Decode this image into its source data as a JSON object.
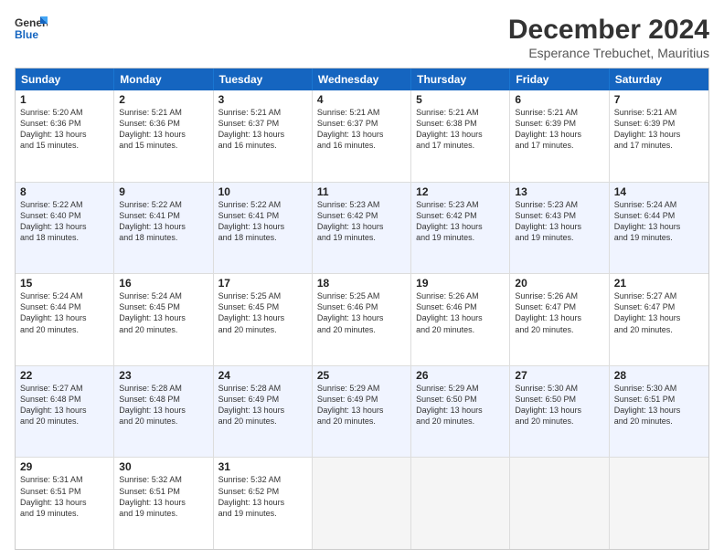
{
  "logo": {
    "line1": "General",
    "line2": "Blue"
  },
  "title": "December 2024",
  "subtitle": "Esperance Trebuchet, Mauritius",
  "header_days": [
    "Sunday",
    "Monday",
    "Tuesday",
    "Wednesday",
    "Thursday",
    "Friday",
    "Saturday"
  ],
  "rows": [
    {
      "alt": false,
      "cells": [
        {
          "day": "1",
          "lines": [
            "Sunrise: 5:20 AM",
            "Sunset: 6:36 PM",
            "Daylight: 13 hours",
            "and 15 minutes."
          ]
        },
        {
          "day": "2",
          "lines": [
            "Sunrise: 5:21 AM",
            "Sunset: 6:36 PM",
            "Daylight: 13 hours",
            "and 15 minutes."
          ]
        },
        {
          "day": "3",
          "lines": [
            "Sunrise: 5:21 AM",
            "Sunset: 6:37 PM",
            "Daylight: 13 hours",
            "and 16 minutes."
          ]
        },
        {
          "day": "4",
          "lines": [
            "Sunrise: 5:21 AM",
            "Sunset: 6:37 PM",
            "Daylight: 13 hours",
            "and 16 minutes."
          ]
        },
        {
          "day": "5",
          "lines": [
            "Sunrise: 5:21 AM",
            "Sunset: 6:38 PM",
            "Daylight: 13 hours",
            "and 17 minutes."
          ]
        },
        {
          "day": "6",
          "lines": [
            "Sunrise: 5:21 AM",
            "Sunset: 6:39 PM",
            "Daylight: 13 hours",
            "and 17 minutes."
          ]
        },
        {
          "day": "7",
          "lines": [
            "Sunrise: 5:21 AM",
            "Sunset: 6:39 PM",
            "Daylight: 13 hours",
            "and 17 minutes."
          ]
        }
      ]
    },
    {
      "alt": true,
      "cells": [
        {
          "day": "8",
          "lines": [
            "Sunrise: 5:22 AM",
            "Sunset: 6:40 PM",
            "Daylight: 13 hours",
            "and 18 minutes."
          ]
        },
        {
          "day": "9",
          "lines": [
            "Sunrise: 5:22 AM",
            "Sunset: 6:41 PM",
            "Daylight: 13 hours",
            "and 18 minutes."
          ]
        },
        {
          "day": "10",
          "lines": [
            "Sunrise: 5:22 AM",
            "Sunset: 6:41 PM",
            "Daylight: 13 hours",
            "and 18 minutes."
          ]
        },
        {
          "day": "11",
          "lines": [
            "Sunrise: 5:23 AM",
            "Sunset: 6:42 PM",
            "Daylight: 13 hours",
            "and 19 minutes."
          ]
        },
        {
          "day": "12",
          "lines": [
            "Sunrise: 5:23 AM",
            "Sunset: 6:42 PM",
            "Daylight: 13 hours",
            "and 19 minutes."
          ]
        },
        {
          "day": "13",
          "lines": [
            "Sunrise: 5:23 AM",
            "Sunset: 6:43 PM",
            "Daylight: 13 hours",
            "and 19 minutes."
          ]
        },
        {
          "day": "14",
          "lines": [
            "Sunrise: 5:24 AM",
            "Sunset: 6:44 PM",
            "Daylight: 13 hours",
            "and 19 minutes."
          ]
        }
      ]
    },
    {
      "alt": false,
      "cells": [
        {
          "day": "15",
          "lines": [
            "Sunrise: 5:24 AM",
            "Sunset: 6:44 PM",
            "Daylight: 13 hours",
            "and 20 minutes."
          ]
        },
        {
          "day": "16",
          "lines": [
            "Sunrise: 5:24 AM",
            "Sunset: 6:45 PM",
            "Daylight: 13 hours",
            "and 20 minutes."
          ]
        },
        {
          "day": "17",
          "lines": [
            "Sunrise: 5:25 AM",
            "Sunset: 6:45 PM",
            "Daylight: 13 hours",
            "and 20 minutes."
          ]
        },
        {
          "day": "18",
          "lines": [
            "Sunrise: 5:25 AM",
            "Sunset: 6:46 PM",
            "Daylight: 13 hours",
            "and 20 minutes."
          ]
        },
        {
          "day": "19",
          "lines": [
            "Sunrise: 5:26 AM",
            "Sunset: 6:46 PM",
            "Daylight: 13 hours",
            "and 20 minutes."
          ]
        },
        {
          "day": "20",
          "lines": [
            "Sunrise: 5:26 AM",
            "Sunset: 6:47 PM",
            "Daylight: 13 hours",
            "and 20 minutes."
          ]
        },
        {
          "day": "21",
          "lines": [
            "Sunrise: 5:27 AM",
            "Sunset: 6:47 PM",
            "Daylight: 13 hours",
            "and 20 minutes."
          ]
        }
      ]
    },
    {
      "alt": true,
      "cells": [
        {
          "day": "22",
          "lines": [
            "Sunrise: 5:27 AM",
            "Sunset: 6:48 PM",
            "Daylight: 13 hours",
            "and 20 minutes."
          ]
        },
        {
          "day": "23",
          "lines": [
            "Sunrise: 5:28 AM",
            "Sunset: 6:48 PM",
            "Daylight: 13 hours",
            "and 20 minutes."
          ]
        },
        {
          "day": "24",
          "lines": [
            "Sunrise: 5:28 AM",
            "Sunset: 6:49 PM",
            "Daylight: 13 hours",
            "and 20 minutes."
          ]
        },
        {
          "day": "25",
          "lines": [
            "Sunrise: 5:29 AM",
            "Sunset: 6:49 PM",
            "Daylight: 13 hours",
            "and 20 minutes."
          ]
        },
        {
          "day": "26",
          "lines": [
            "Sunrise: 5:29 AM",
            "Sunset: 6:50 PM",
            "Daylight: 13 hours",
            "and 20 minutes."
          ]
        },
        {
          "day": "27",
          "lines": [
            "Sunrise: 5:30 AM",
            "Sunset: 6:50 PM",
            "Daylight: 13 hours",
            "and 20 minutes."
          ]
        },
        {
          "day": "28",
          "lines": [
            "Sunrise: 5:30 AM",
            "Sunset: 6:51 PM",
            "Daylight: 13 hours",
            "and 20 minutes."
          ]
        }
      ]
    },
    {
      "alt": false,
      "cells": [
        {
          "day": "29",
          "lines": [
            "Sunrise: 5:31 AM",
            "Sunset: 6:51 PM",
            "Daylight: 13 hours",
            "and 19 minutes."
          ]
        },
        {
          "day": "30",
          "lines": [
            "Sunrise: 5:32 AM",
            "Sunset: 6:51 PM",
            "Daylight: 13 hours",
            "and 19 minutes."
          ]
        },
        {
          "day": "31",
          "lines": [
            "Sunrise: 5:32 AM",
            "Sunset: 6:52 PM",
            "Daylight: 13 hours",
            "and 19 minutes."
          ]
        },
        {
          "day": "",
          "lines": []
        },
        {
          "day": "",
          "lines": []
        },
        {
          "day": "",
          "lines": []
        },
        {
          "day": "",
          "lines": []
        }
      ]
    }
  ]
}
